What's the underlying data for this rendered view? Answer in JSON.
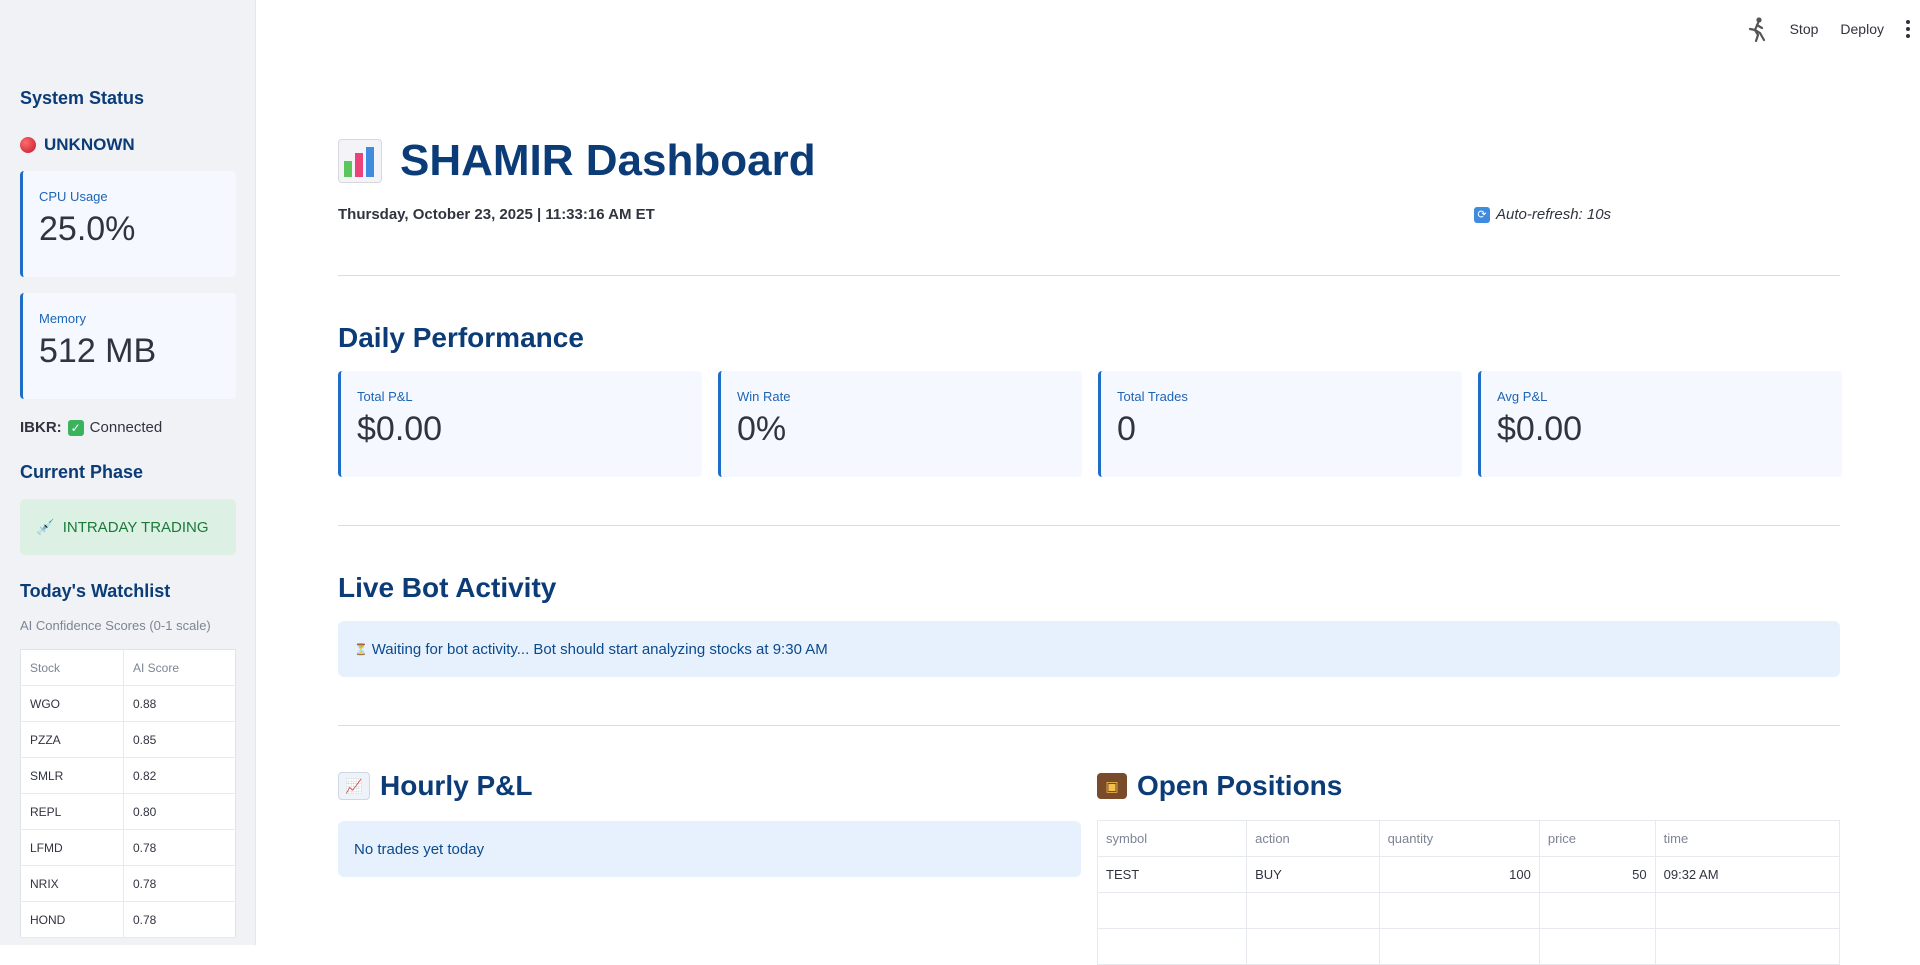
{
  "sidebar": {
    "system_status_title": "System Status",
    "status_text": "UNKNOWN",
    "status_color": "#c0182c",
    "cpu": {
      "label": "CPU Usage",
      "value": "25.0%"
    },
    "memory": {
      "label": "Memory",
      "value": "512 MB"
    },
    "ibkr": {
      "label": "IBKR:",
      "value": "Connected"
    },
    "phase_title": "Current Phase",
    "phase": {
      "icon": "syringe-icon",
      "text": "INTRADAY TRADING"
    },
    "watchlist_title": "Today's Watchlist",
    "watchlist_caption": "AI Confidence Scores (0-1 scale)",
    "watchlist_columns": [
      "Stock",
      "AI Score"
    ],
    "watchlist": [
      {
        "stock": "WGO",
        "score": "0.88"
      },
      {
        "stock": "PZZA",
        "score": "0.85"
      },
      {
        "stock": "SMLR",
        "score": "0.82"
      },
      {
        "stock": "REPL",
        "score": "0.80"
      },
      {
        "stock": "LFMD",
        "score": "0.78"
      },
      {
        "stock": "NRIX",
        "score": "0.78"
      },
      {
        "stock": "HOND",
        "score": "0.78"
      }
    ]
  },
  "topbar": {
    "stop_label": "Stop",
    "deploy_label": "Deploy",
    "running_icon": "running-man-icon"
  },
  "header": {
    "title": "SHAMIR Dashboard",
    "datetime": "Thursday, October 23, 2025 | 11:33:16 AM ET",
    "refresh": "Auto-refresh: 10s"
  },
  "performance": {
    "title": "Daily Performance",
    "metrics": [
      {
        "label": "Total P&L",
        "value": "$0.00"
      },
      {
        "label": "Win Rate",
        "value": "0%"
      },
      {
        "label": "Total Trades",
        "value": "0"
      },
      {
        "label": "Avg P&L",
        "value": "$0.00"
      }
    ]
  },
  "activity": {
    "title": "Live Bot Activity",
    "message": "Waiting for bot activity... Bot should start analyzing stocks at 9:30 AM"
  },
  "hourly": {
    "title": "Hourly P&L",
    "empty": "No trades yet today"
  },
  "positions": {
    "title": "Open Positions",
    "columns": [
      "symbol",
      "action",
      "quantity",
      "price",
      "time"
    ],
    "rows": [
      {
        "symbol": "TEST",
        "action": "BUY",
        "quantity": "100",
        "price": "50",
        "time": "09:32 AM"
      }
    ]
  }
}
